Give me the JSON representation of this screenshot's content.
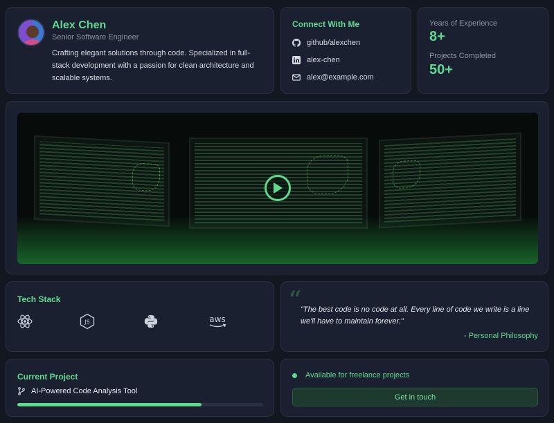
{
  "profile": {
    "name": "Alex Chen",
    "role": "Senior Software Engineer",
    "bio": "Crafting elegant solutions through code. Specialized in full-stack development with a passion for clean architecture and scalable systems.",
    "avatar_icon": "user-avatar"
  },
  "connect": {
    "title": "Connect With Me",
    "links": [
      {
        "icon": "github-icon",
        "label": "github/alexchen"
      },
      {
        "icon": "linkedin-icon",
        "label": "alex-chen"
      },
      {
        "icon": "mail-icon",
        "label": "alex@example.com"
      }
    ]
  },
  "stats": {
    "experience_label": "Years of Experience",
    "experience_value": "8+",
    "projects_label": "Projects Completed",
    "projects_value": "50+"
  },
  "video": {
    "play_icon": "play-icon"
  },
  "tech_stack": {
    "title": "Tech Stack",
    "items": [
      "react-icon",
      "nodejs-icon",
      "python-icon",
      "aws-icon"
    ],
    "aws_text": "aws"
  },
  "quote": {
    "text": "\"The best code is no code at all. Every line of code we write is a line we'll have to maintain forever.\"",
    "author": "- Personal Philosophy"
  },
  "current_project": {
    "title": "Current Project",
    "name": "AI-Powered Code Analysis Tool",
    "progress_fraction": 0.75
  },
  "availability": {
    "status": "Available for freelance projects",
    "cta_label": "Get in touch"
  },
  "colors": {
    "accent": "#5fd990",
    "background": "#121722",
    "card": "#1a2030"
  }
}
